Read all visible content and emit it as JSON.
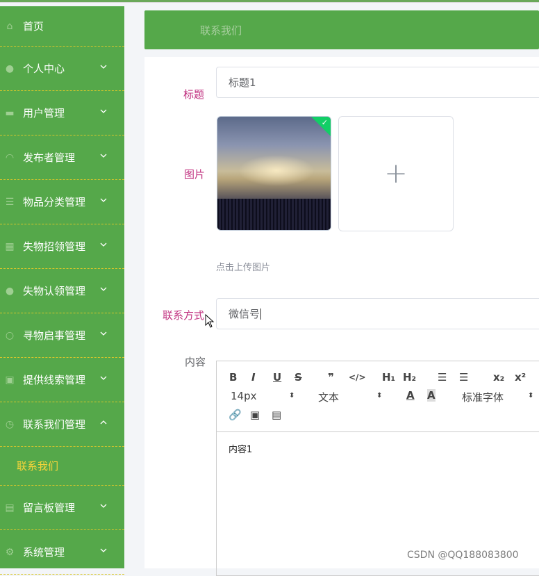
{
  "sidebar": {
    "items": [
      {
        "label": "首页",
        "icon": "home-icon"
      },
      {
        "label": "个人中心",
        "icon": "user-icon"
      },
      {
        "label": "用户管理",
        "icon": "briefcase-icon"
      },
      {
        "label": "发布者管理",
        "icon": "headset-icon"
      },
      {
        "label": "物品分类管理",
        "icon": "list-icon"
      },
      {
        "label": "失物招领管理",
        "icon": "grid-icon"
      },
      {
        "label": "失物认领管理",
        "icon": "person-icon"
      },
      {
        "label": "寻物启事管理",
        "icon": "circle-icon"
      },
      {
        "label": "提供线索管理",
        "icon": "card-icon"
      },
      {
        "label": "联系我们管理",
        "icon": "clock-icon"
      },
      {
        "label": "留言板管理",
        "icon": "clipboard-icon"
      },
      {
        "label": "系统管理",
        "icon": "gear-icon"
      }
    ],
    "sub_item": "联系我们"
  },
  "header": {
    "title": "联系我们"
  },
  "form": {
    "title_label": "标题",
    "title_value": "标题1",
    "image_label": "图片",
    "upload_plus": "+",
    "upload_hint": "点击上传图片",
    "contact_label": "联系方式",
    "contact_value": "微信号",
    "content_label": "内容"
  },
  "editor": {
    "bold": "B",
    "italic": "I",
    "underline": "U",
    "strike": "S",
    "quote": "❞",
    "code": "</>",
    "h1": "H₁",
    "h2": "H₂",
    "ordered_list": "☰",
    "bullet_list": "☰",
    "sub": "x₂",
    "sup": "x²",
    "font_size": "14px",
    "format": "文本",
    "color": "A",
    "bg": "A",
    "font_family": "标准字体",
    "link": "🔗",
    "image": "▣",
    "video": "▤",
    "content": "内容1"
  },
  "watermark": "CSDN @QQ188083800",
  "colors": {
    "sidebar": "#55a84a",
    "label": "#c0307f",
    "sub_active": "#f5d43a"
  }
}
